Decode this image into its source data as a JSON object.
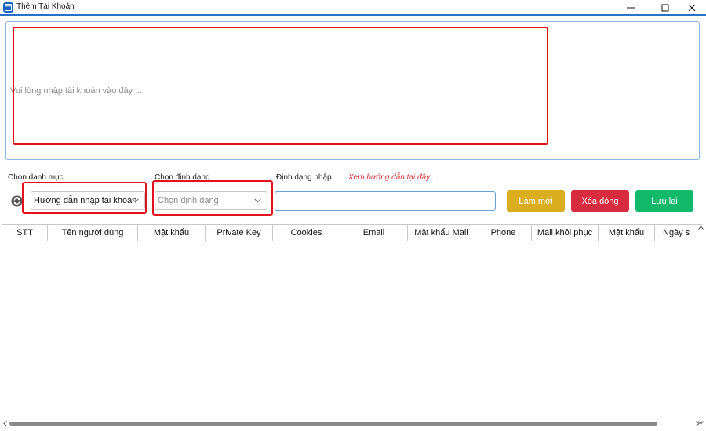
{
  "window": {
    "title": "Thêm Tài Khoản",
    "app_icon": "web-window-icon",
    "minimize_glyph": "—",
    "maximize_glyph": "☐",
    "close_glyph": "✕"
  },
  "account_input": {
    "placeholder": "Vui lòng nhập tài khoản vào đây ...",
    "value": ""
  },
  "category": {
    "label": "Chọn danh mục",
    "selected": "Hướng dẫn nhập tài khoản"
  },
  "format_select": {
    "label": "Chọn định dạng",
    "placeholder": "Chọn định dạng"
  },
  "input_format": {
    "label": "Định dạng nhập",
    "guide_link": "Xem hướng dẫn tại đây ...",
    "value": ""
  },
  "buttons": {
    "refresh": "Làm mới",
    "delete_row": "Xóa dòng",
    "save": "Lưu lại"
  },
  "table": {
    "columns": [
      "STT",
      "Tên người dùng",
      "Mật khẩu",
      "Private Key",
      "Cookies",
      "Email",
      "Mật khẩu Mail",
      "Phone",
      "Mail khôi phục",
      "Mật khẩu",
      "Ngày s"
    ],
    "rows": []
  },
  "colors": {
    "accent": "#2a6fcb",
    "highlight_box": "#e0121b",
    "refresh_button": "#d9ad1e",
    "delete_button": "#d92b3f",
    "save_button": "#12b96b",
    "guide_link": "#d6323c"
  }
}
